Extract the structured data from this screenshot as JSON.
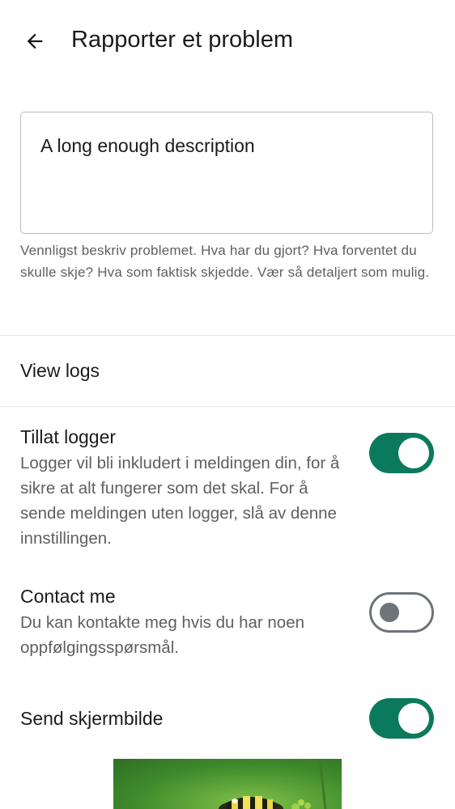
{
  "header": {
    "title": "Rapporter et problem",
    "back_icon": "arrow-left-icon"
  },
  "description": {
    "value": "A long enough description",
    "helper": "Vennligst beskriv problemet. Hva har du gjort? Hva forventet du skulle skje? Hva som faktisk skjedde. Vær så detaljert som mulig."
  },
  "view_logs": {
    "label": "View logs"
  },
  "settings": {
    "allow_logs": {
      "title": "Tillat logger",
      "subtitle": "Logger vil bli inkludert i meldingen din, for å sikre at alt fungerer som det skal. For å sende meldingen uten logger, slå av denne innstillingen.",
      "enabled": true
    },
    "contact_me": {
      "title": "Contact me",
      "subtitle": "Du kan kontakte meg hvis du har noen oppfølgingsspørsmål.",
      "enabled": false
    },
    "send_screenshot": {
      "title": "Send skjermbilde",
      "enabled": true
    }
  },
  "colors": {
    "accent": "#0b7a5c",
    "switch_off": "#6f7479",
    "secondary_text": "#5f5f5f",
    "divider": "#e6e6e6"
  }
}
